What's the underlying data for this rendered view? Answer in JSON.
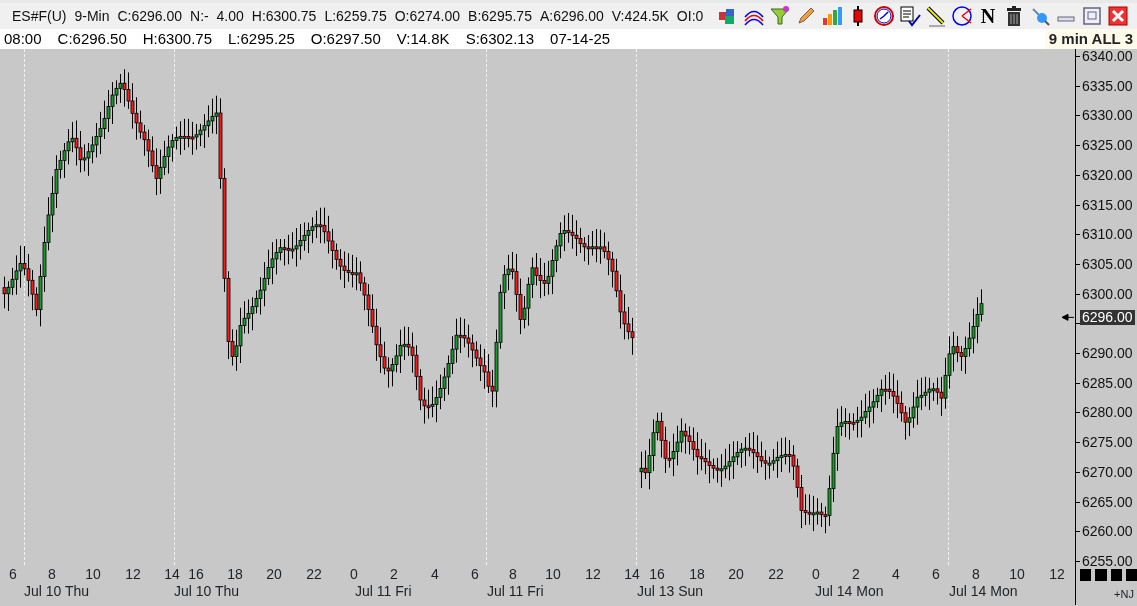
{
  "header": {
    "quote_fields": [
      "ES#F(U)",
      "9-Min",
      "C:6296.00",
      "N:-  4.00",
      "H:6300.75",
      "L:6259.75",
      "O:6274.00",
      "B:6295.75",
      "A:6296.00",
      "V:424.5K",
      "OI:0"
    ],
    "bar_fields": [
      "08:00",
      "C:6296.50",
      "H:6300.75",
      "L:6295.25",
      "O:6297.50",
      "V:14.8K",
      "S:6302.13",
      "07-14-25"
    ],
    "interval_label": "9 min ALL 3",
    "toolbar": [
      {
        "kind": "cubes"
      },
      {
        "kind": "arcs"
      },
      {
        "kind": "funnel"
      },
      {
        "kind": "pencil"
      },
      {
        "kind": "bars"
      },
      {
        "kind": "candle"
      },
      {
        "kind": "clock"
      },
      {
        "kind": "checklist"
      },
      {
        "kind": "line-tool"
      },
      {
        "kind": "angle"
      },
      {
        "kind": "letter",
        "text": "N"
      },
      {
        "kind": "trash"
      },
      {
        "kind": "pin"
      },
      {
        "kind": "minimize"
      },
      {
        "kind": "restore"
      },
      {
        "kind": "close"
      }
    ]
  },
  "price_axis": {
    "ticks": [
      "6340.00",
      "6335.00",
      "6330.00",
      "6325.00",
      "6320.00",
      "6315.00",
      "6310.00",
      "6305.00",
      "6300.00",
      "6290.00",
      "6285.00",
      "6280.00",
      "6275.00",
      "6270.00",
      "6265.00",
      "6260.00",
      "6255.00"
    ],
    "last_price": "6296.00"
  },
  "time_axis": {
    "hours": [
      "6",
      "8",
      "10",
      "12",
      "14",
      "16",
      "18",
      "20",
      "22",
      "0",
      "2",
      "4",
      "6",
      "8",
      "10",
      "12",
      "14",
      "16",
      "18",
      "20",
      "22",
      "0",
      "2",
      "4",
      "6",
      "8",
      "10",
      "12"
    ],
    "dates": [
      "Jul 10 Thu",
      "Jul 10 Thu",
      "Jul 11 Fri",
      "Jul 11 Fri",
      "Jul 13 Sun",
      "Jul 14 Mon",
      "Jul 14 Mon"
    ],
    "corner_label": "+NJ"
  }
}
